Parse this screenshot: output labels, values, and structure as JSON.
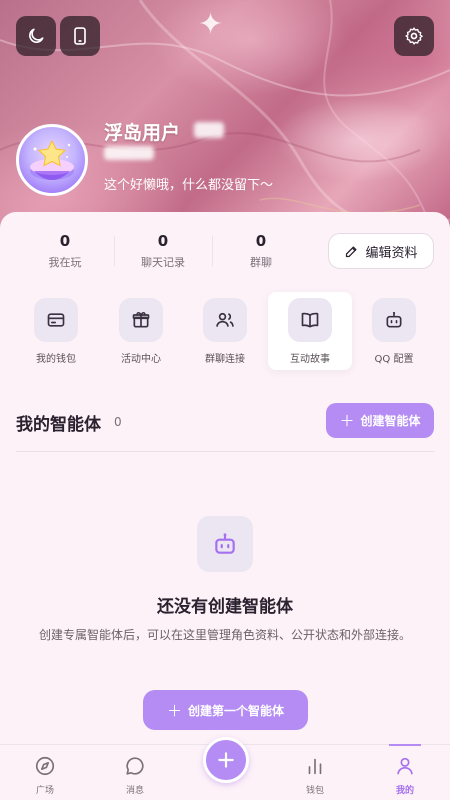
{
  "profile": {
    "username": "浮岛用户",
    "bio": "这个好懒哦，什么都没留下～"
  },
  "stats": [
    {
      "value": "0",
      "label": "我在玩"
    },
    {
      "value": "0",
      "label": "聊天记录"
    },
    {
      "value": "0",
      "label": "群聊"
    }
  ],
  "edit_button": "编辑资料",
  "actions": [
    {
      "label": "我的钱包",
      "icon": "wallet-icon"
    },
    {
      "label": "活动中心",
      "icon": "gift-icon"
    },
    {
      "label": "群聊连接",
      "icon": "users-icon"
    },
    {
      "label": "互动故事",
      "icon": "book-icon"
    },
    {
      "label": "QQ 配置",
      "icon": "robot-icon"
    }
  ],
  "agents": {
    "title": "我的智能体",
    "count": "0",
    "create_button": "创建智能体"
  },
  "empty": {
    "title": "还没有创建智能体",
    "description": "创建专属智能体后，可以在这里管理角色资料、公开状态和外部连接。",
    "button": "创建第一个智能体"
  },
  "tabs": [
    {
      "label": "广场",
      "icon": "compass-icon"
    },
    {
      "label": "消息",
      "icon": "chat-icon"
    },
    {
      "label": "钱包",
      "icon": "chart-icon"
    },
    {
      "label": "我的",
      "icon": "user-icon"
    }
  ],
  "colors": {
    "accent": "#b48cf3",
    "background": "#fdf2f8",
    "active_tab": "#a470ef"
  }
}
